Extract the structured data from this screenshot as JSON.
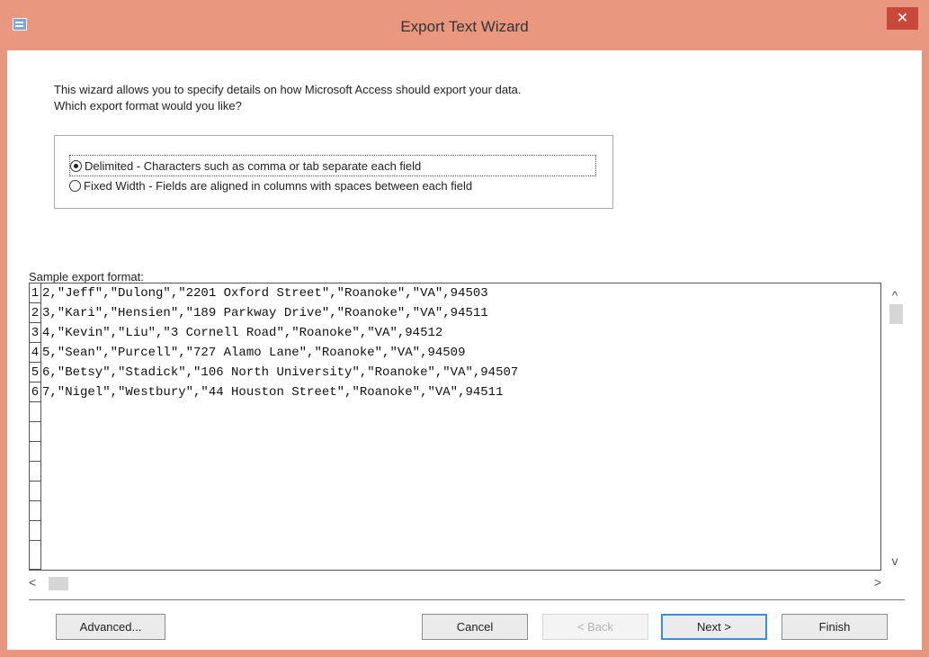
{
  "window": {
    "title": "Export Text Wizard",
    "close_label": "✕"
  },
  "intro": {
    "line1": "This wizard allows you to specify details on how Microsoft Access should export your data.",
    "line2": "Which export format would you like?"
  },
  "format_options": [
    {
      "label": "Delimited - Characters such as comma or tab separate each field",
      "selected": true
    },
    {
      "label": "Fixed Width - Fields are aligned in columns with spaces between each field",
      "selected": false
    }
  ],
  "sample": {
    "label": "Sample export format:",
    "rows": [
      {
        "num": "1",
        "text": "2,\"Jeff\",\"Dulong\",\"2201 Oxford Street\",\"Roanoke\",\"VA\",94503"
      },
      {
        "num": "2",
        "text": "3,\"Kari\",\"Hensien\",\"189 Parkway Drive\",\"Roanoke\",\"VA\",94511"
      },
      {
        "num": "3",
        "text": "4,\"Kevin\",\"Liu\",\"3 Cornell Road\",\"Roanoke\",\"VA\",94512"
      },
      {
        "num": "4",
        "text": "5,\"Sean\",\"Purcell\",\"727 Alamo Lane\",\"Roanoke\",\"VA\",94509"
      },
      {
        "num": "5",
        "text": "6,\"Betsy\",\"Stadick\",\"106 North University\",\"Roanoke\",\"VA\",94507"
      },
      {
        "num": "6",
        "text": "7,\"Nigel\",\"Westbury\",\"44 Houston Street\",\"Roanoke\",\"VA\",94511"
      }
    ]
  },
  "buttons": {
    "advanced": "Advanced...",
    "cancel": "Cancel",
    "back": "< Back",
    "next": "Next >",
    "finish": "Finish"
  },
  "scroll_glyphs": {
    "up": "^",
    "down": "v",
    "left": "<",
    "right": ">"
  },
  "colors": {
    "titlebar": "#e9977e",
    "close_button": "#c9473b",
    "default_button_border": "#3c8fd8"
  },
  "icons": {
    "app": "access-table-icon",
    "close": "close-icon"
  }
}
